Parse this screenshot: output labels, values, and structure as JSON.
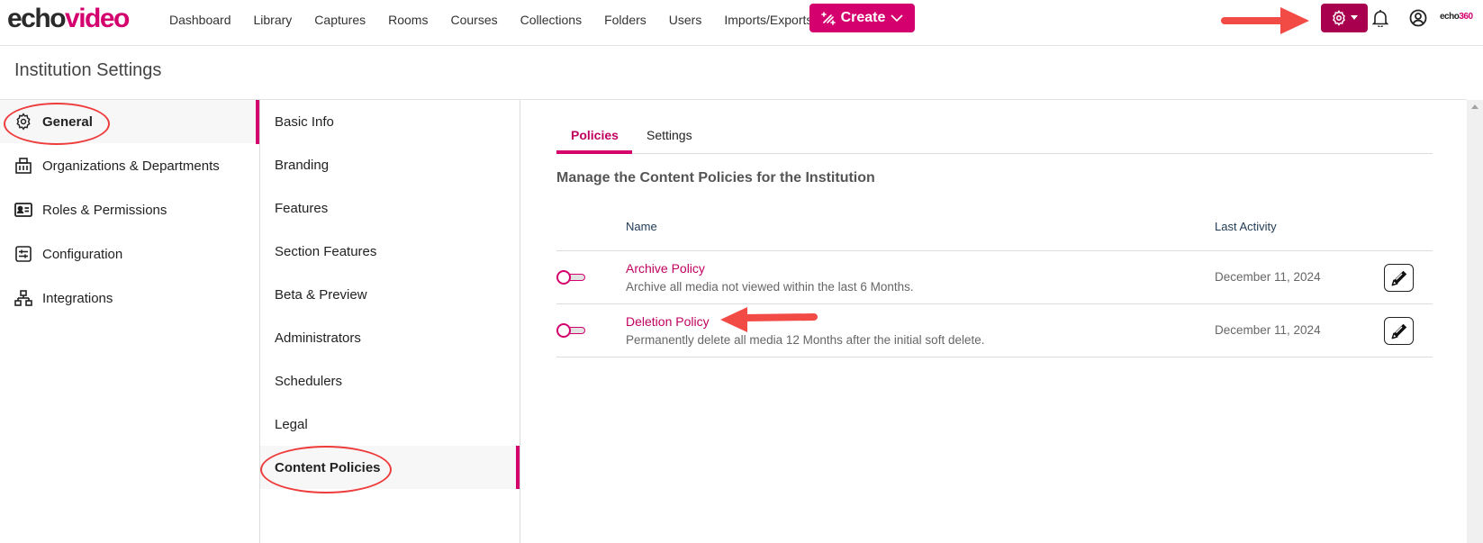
{
  "brand": {
    "logo_part1": "echo",
    "logo_part2": "video",
    "small_part1": "echo",
    "small_part2": "360"
  },
  "nav": {
    "items": [
      "Dashboard",
      "Library",
      "Captures",
      "Rooms",
      "Courses",
      "Collections",
      "Folders",
      "Users",
      "Imports/Exports"
    ],
    "create_label": "Create",
    "icons": {
      "create": "magic-wand-icon",
      "settings": "gear-icon",
      "notifications": "bell-icon",
      "account": "user-circle-icon"
    }
  },
  "page": {
    "title": "Institution Settings"
  },
  "sidebar": {
    "items": [
      {
        "label": "General",
        "icon": "gear-icon",
        "active": true
      },
      {
        "label": "Organizations & Departments",
        "icon": "building-icon",
        "active": false
      },
      {
        "label": "Roles & Permissions",
        "icon": "id-card-icon",
        "active": false
      },
      {
        "label": "Configuration",
        "icon": "sliders-icon",
        "active": false
      },
      {
        "label": "Integrations",
        "icon": "network-icon",
        "active": false
      }
    ]
  },
  "subnav": {
    "items": [
      {
        "label": "Basic Info",
        "active": false
      },
      {
        "label": "Branding",
        "active": false
      },
      {
        "label": "Features",
        "active": false
      },
      {
        "label": "Section Features",
        "active": false
      },
      {
        "label": "Beta & Preview",
        "active": false
      },
      {
        "label": "Administrators",
        "active": false
      },
      {
        "label": "Schedulers",
        "active": false
      },
      {
        "label": "Legal",
        "active": false
      },
      {
        "label": "Content Policies",
        "active": true
      }
    ]
  },
  "content": {
    "tabs": [
      {
        "label": "Policies",
        "active": true
      },
      {
        "label": "Settings",
        "active": false
      }
    ],
    "heading": "Manage the Content Policies for the Institution",
    "columns": {
      "name": "Name",
      "last_activity": "Last Activity"
    },
    "policies": [
      {
        "name": "Archive Policy",
        "description": "Archive all media not viewed within the last 6 Months.",
        "last_activity": "December 11, 2024",
        "enabled": false
      },
      {
        "name": "Deletion Policy",
        "description": "Permanently delete all media 12 Months after the initial soft delete.",
        "last_activity": "December 11, 2024",
        "enabled": false
      }
    ]
  },
  "colors": {
    "accent": "#d4006e",
    "accent_dark": "#a8004f",
    "annotation": "#ee3c3c"
  }
}
